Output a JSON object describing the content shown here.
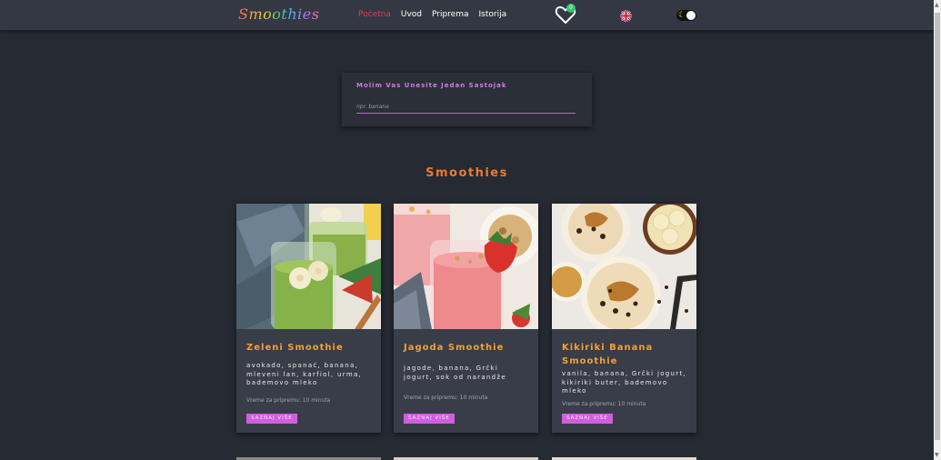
{
  "nav": {
    "logo": "Smoothies",
    "links": [
      "Početna",
      "Uvod",
      "Priprema",
      "Istorija"
    ],
    "favorites_count": "0",
    "language_icon": "uk-flag-icon",
    "theme_icon": "moon-icon"
  },
  "search": {
    "label": "Molim Vas Unesite Jedan Sastojak",
    "placeholder": "npr. banana",
    "value": ""
  },
  "section_title": "Smoothies",
  "cards": [
    {
      "title": "Zeleni Smoothie",
      "ingredients": "avokado, spanać, banana, mleveni lan, karfiol, urma, bademovo mleko",
      "time": "Vreme za pripremu: 10 minuta",
      "button": "SAZNAJ VIŠE"
    },
    {
      "title": "Jagoda Smoothie",
      "ingredients": "jagode, banana, Grčki jogurt, sok od narandže",
      "time": "Vreme za pripremu: 10 minuta",
      "button": "SAZNAJ VIŠE"
    },
    {
      "title": "Kikiriki Banana Smoothie",
      "ingredients": "vanila, banana, Grčki jogurt, kikiriki buter, bademovo mleko",
      "time": "Vreme za pripremu: 10 minuta",
      "button": "SAZNAJ VIŠE"
    }
  ],
  "colors": {
    "background": "#262a32",
    "navbar": "#343842",
    "card": "#393d47",
    "accent_orange": "#ef7a2e",
    "accent_title": "#f1a13a",
    "accent_pink": "#cf5fdf",
    "nav_active": "#e23b55"
  }
}
